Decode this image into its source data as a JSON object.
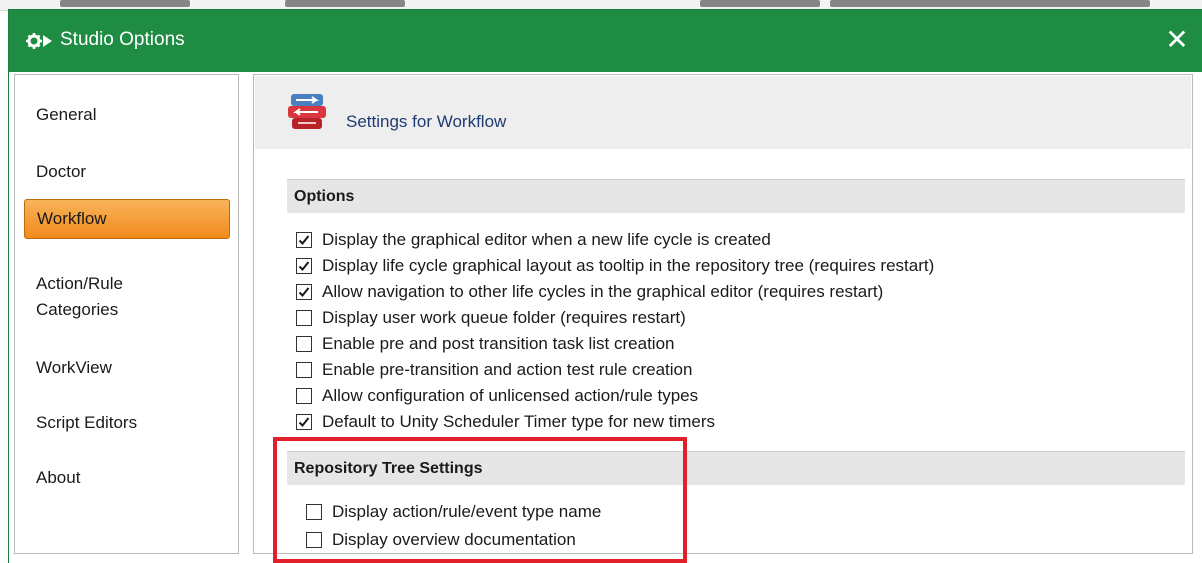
{
  "window": {
    "title": "Studio Options",
    "close_glyph": "✕",
    "icon": "gear-arrow-icon",
    "title_bar_color": "#1e8d43"
  },
  "sidebar": {
    "items": [
      {
        "label": "General",
        "selected": false
      },
      {
        "label": "Doctor",
        "selected": false
      },
      {
        "label": "Workflow",
        "selected": true
      },
      {
        "label": "Action/Rule\nCategories",
        "selected": false
      },
      {
        "label": "WorkView",
        "selected": false
      },
      {
        "label": "Script Editors",
        "selected": false
      },
      {
        "label": "About",
        "selected": false
      }
    ],
    "selected_color": "#f39a2d"
  },
  "content": {
    "title": "Settings for Workflow",
    "icon": "workflow-icon",
    "sections": [
      {
        "header": "Options",
        "options": [
          {
            "label": "Display the graphical editor when a new life cycle is created",
            "checked": true
          },
          {
            "label": "Display life cycle graphical layout as tooltip in the repository tree (requires restart)",
            "checked": true
          },
          {
            "label": "Allow navigation to other life cycles in the graphical editor (requires restart)",
            "checked": true
          },
          {
            "label": "Display user work queue folder (requires restart)",
            "checked": false
          },
          {
            "label": "Enable pre and post transition task list creation",
            "checked": false
          },
          {
            "label": "Enable pre-transition and action test rule creation",
            "checked": false
          },
          {
            "label": "Allow configuration of unlicensed action/rule types",
            "checked": false
          },
          {
            "label": "Default to Unity Scheduler Timer type for new timers",
            "checked": true
          }
        ]
      },
      {
        "header": "Repository Tree Settings",
        "options": [
          {
            "label": "Display action/rule/event type name",
            "checked": false
          },
          {
            "label": "Display overview documentation",
            "checked": false
          }
        ]
      }
    ]
  },
  "annotation": {
    "highlight_color": "#e0202a"
  }
}
